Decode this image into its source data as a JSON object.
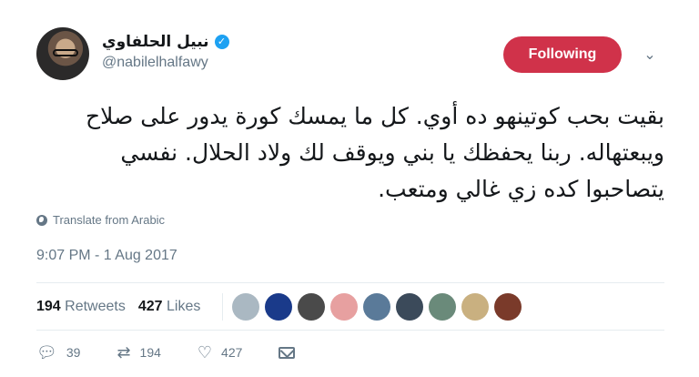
{
  "author": {
    "display_name": "نبيل الحلفاوي",
    "handle": "@nabilelhalfawy",
    "verified": true
  },
  "follow_button": {
    "label": "Following",
    "color": "#d0324a"
  },
  "tweet": {
    "text": "بقيت بحب كوتينهو ده أوي. كل ما يمسك كورة يدور على صلاح ويبعتهاله. ربنا يحفظك يا بني ويوقف لك ولاد الحلال. نفسي يتصاحبوا كده زي غالي ومتعب."
  },
  "translate_label": "Translate from Arabic",
  "timestamp": "9:07 PM - 1 Aug 2017",
  "stats": {
    "retweets_count": "194",
    "retweets_label": "Retweets",
    "likes_count": "427",
    "likes_label": "Likes"
  },
  "likers": [
    "#aab8c2",
    "#1a3a8a",
    "#4a4a4a",
    "#e7a0a0",
    "#5a7a99",
    "#3b4a5a",
    "#6a8a7a",
    "#c9b080",
    "#7a3a2a"
  ],
  "actions": {
    "reply_count": "39",
    "retweet_count": "194",
    "like_count": "427"
  },
  "colors": {
    "accent": "#1da1f2",
    "muted": "#657786",
    "text": "#14171a"
  }
}
